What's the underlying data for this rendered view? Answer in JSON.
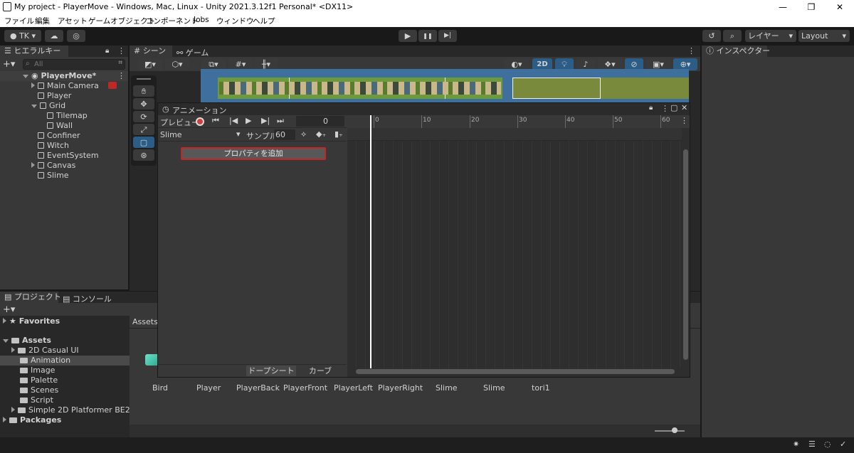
{
  "window": {
    "title": "My project - PlayerMove - Windows, Mac, Linux - Unity 2021.3.12f1 Personal* <DX11>",
    "min": "—",
    "max": "❐",
    "close": "✕"
  },
  "menu": [
    "ファイル",
    "編集",
    "アセット",
    "ゲームオブジェクト",
    "コンポーネント",
    "Jobs",
    "ウィンドウ",
    "ヘルプ"
  ],
  "toolbar": {
    "account": "TK",
    "play": "▶",
    "pause": "❚❚",
    "step": "▶|",
    "layers": "レイヤー",
    "layout": "Layout"
  },
  "hierarchy": {
    "tab": "ヒエラルキー",
    "search_placeholder": "All",
    "scene": "PlayerMove*",
    "items": [
      "Main Camera",
      "Player",
      "Grid",
      "Tilemap",
      "Wall",
      "Confiner",
      "Witch",
      "EventSystem",
      "Canvas",
      "Slime"
    ]
  },
  "scene_tabs": {
    "scene": "シーン",
    "game": "ゲーム",
    "mode2d": "2D"
  },
  "inspector": {
    "tab": "インスペクター"
  },
  "project": {
    "tab_project": "プロジェクト",
    "tab_console": "コンソール",
    "favorites": "Favorites",
    "assets": "Assets",
    "packages": "Packages",
    "breadcrumb": "Assets",
    "folders": [
      "2D Casual UI",
      "Animation",
      "Image",
      "Palette",
      "Scenes",
      "Script",
      "Simple 2D Platformer BE2"
    ],
    "selected_folder": "Animation",
    "files": [
      "Bird",
      "Player",
      "PlayerBack",
      "PlayerFront",
      "PlayerLeft",
      "PlayerRight",
      "Slime",
      "Slime",
      "tori1"
    ]
  },
  "animation": {
    "tab": "アニメーション",
    "preview": "プレビュー",
    "frame": "0",
    "clip": "Slime",
    "sample_label": "サンプル",
    "sample": "60",
    "add_property": "プロパティを追加",
    "dopesheet": "ドープシート",
    "curves": "カーブ",
    "ticks": [
      "0",
      "10",
      "20",
      "30",
      "40",
      "50",
      "60"
    ]
  },
  "misc": {
    "side_number": "6"
  },
  "colors": {
    "accent_red": "#c02828",
    "selected_blue": "#2c5d87",
    "timeline_white": "#ffffff"
  }
}
